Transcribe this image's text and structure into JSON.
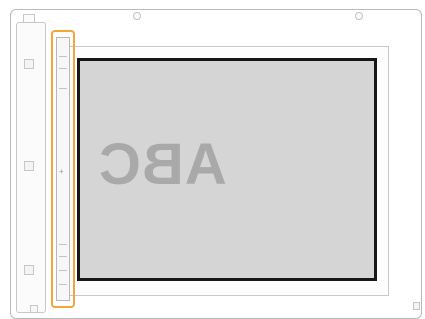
{
  "illustration": {
    "document_text": "ABC",
    "document_text_orientation": "mirrored",
    "highlight_color": "#f0a63a",
    "document_border_color": "#161616",
    "document_fill_color": "#d5d5d5"
  },
  "icons": {
    "alignment_guide": "scanner-alignment-guide-icon",
    "screw": "screw-icon"
  }
}
